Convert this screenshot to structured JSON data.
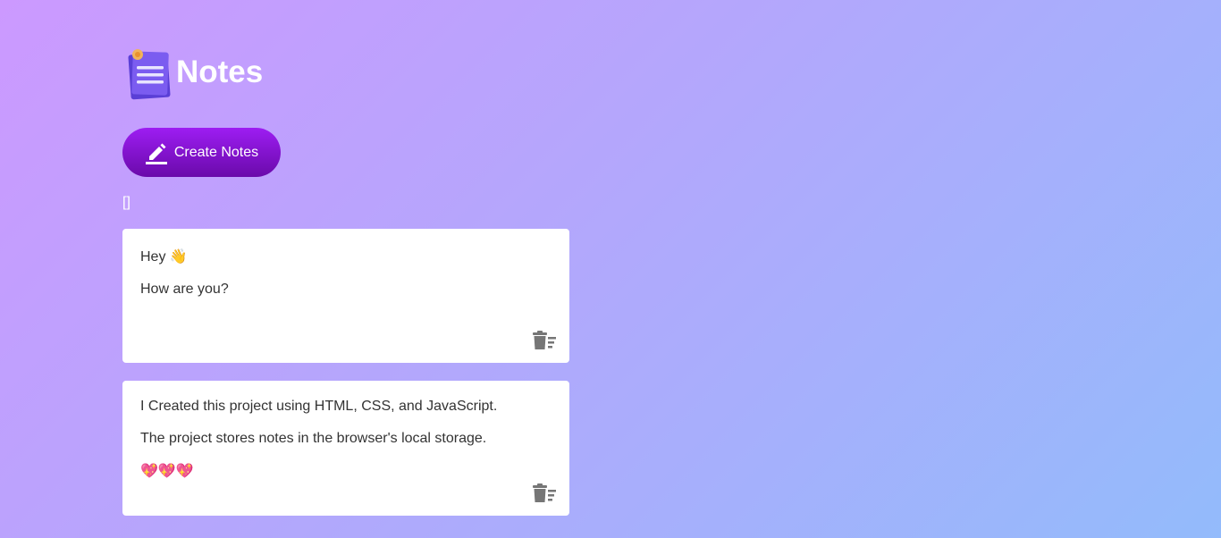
{
  "app": {
    "title": "Notes",
    "logo_icon": "notepad-icon"
  },
  "toolbar": {
    "create_label": "Create Notes",
    "create_icon": "pencil-icon"
  },
  "debug_output": "[]",
  "notes": [
    {
      "lines": [
        "Hey 👋",
        "How are you?"
      ],
      "delete_icon": "trash-icon"
    },
    {
      "lines": [
        "I Created this project using HTML, CSS, and JavaScript.",
        "The project stores notes in the browser's local storage.",
        "💖💖💖"
      ],
      "delete_icon": "trash-icon"
    }
  ],
  "colors": {
    "button_start": "#9d1df2",
    "button_end": "#6a0aaa",
    "background_start": "#cc99ff",
    "background_end": "#93bbfb",
    "icon_gray": "#767676"
  }
}
